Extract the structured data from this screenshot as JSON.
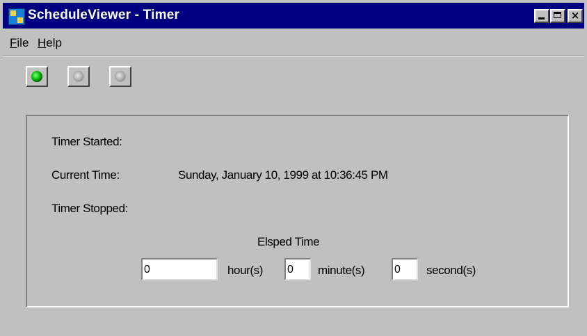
{
  "window": {
    "title": "ScheduleViewer - Timer",
    "icon": "app-calendar-icon",
    "controls": {
      "minimize": "minimize-icon",
      "maximize": "maximize-icon",
      "close": "×"
    }
  },
  "menu": {
    "file": {
      "mnemonic": "F",
      "rest": "ile"
    },
    "help": {
      "mnemonic": "H",
      "rest": "elp"
    }
  },
  "toolbar": {
    "buttons": [
      {
        "name": "start",
        "icon": "green-led-icon",
        "enabled": true
      },
      {
        "name": "stop",
        "icon": "gray-led-icon",
        "enabled": false
      },
      {
        "name": "reset",
        "icon": "gray-led-icon",
        "enabled": false
      }
    ]
  },
  "timer": {
    "started_label": "Timer Started:",
    "started_value": "",
    "current_label": "Current Time:",
    "current_value": "Sunday, January 10, 1999 at 10:36:45 PM",
    "stopped_label": "Timer Stopped:",
    "stopped_value": ""
  },
  "elapsed": {
    "title": "Elsped Time",
    "hours_value": "0",
    "hours_unit": "hour(s)",
    "minutes_value": "0",
    "minutes_unit": "minute(s)",
    "seconds_value": "0",
    "seconds_unit": "second(s)"
  },
  "colors": {
    "titlebar": "#000080",
    "face": "#c0c0c0",
    "led_on": "#00c000"
  }
}
